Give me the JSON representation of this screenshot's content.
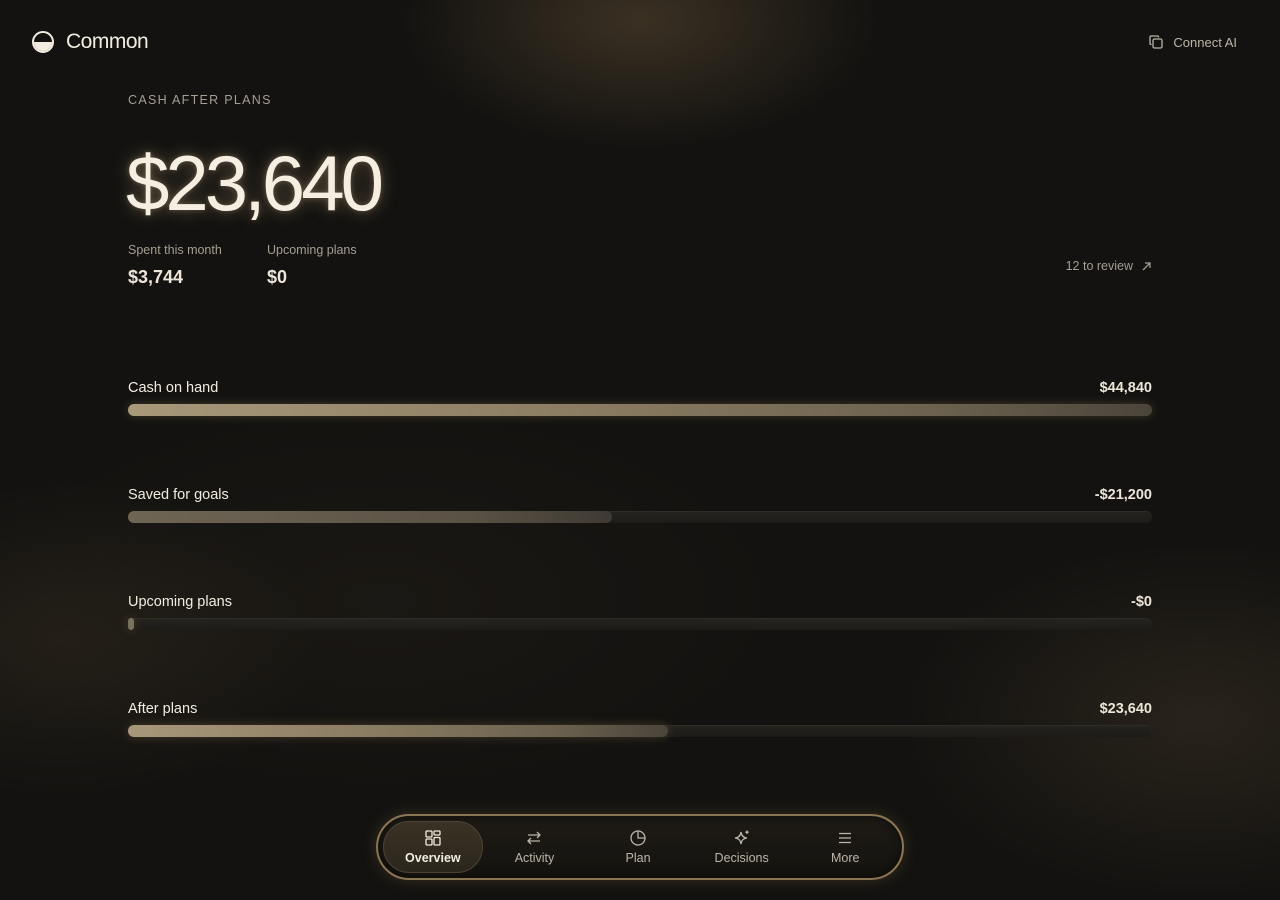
{
  "brand": {
    "name": "Common",
    "logo_icon": "half-circle-logo"
  },
  "header": {
    "connect_label": "Connect AI",
    "connect_icon": "copy-icon"
  },
  "hero": {
    "overline": "CASH AFTER PLANS",
    "value": "$23,640"
  },
  "stats": [
    {
      "label": "Spent this month",
      "value": "$3,744"
    },
    {
      "label": "Upcoming plans",
      "value": "$0"
    }
  ],
  "review": {
    "label": "12 to review",
    "icon": "arrow-up-right-icon"
  },
  "bars": [
    {
      "label": "Cash on hand",
      "value": "$44,840",
      "fill_fraction": 1.0,
      "style": "bright"
    },
    {
      "label": "Saved for goals",
      "value": "-$21,200",
      "fill_fraction": 0.473,
      "style": "dim"
    },
    {
      "label": "Upcoming plans",
      "value": "-$0",
      "fill_fraction": 0.005,
      "style": "tiny"
    },
    {
      "label": "After plans",
      "value": "$23,640",
      "fill_fraction": 0.527,
      "style": "bright"
    }
  ],
  "nav": {
    "items": [
      {
        "label": "Overview",
        "icon": "grid-icon",
        "active": true
      },
      {
        "label": "Activity",
        "icon": "swap-arrows-icon",
        "active": false
      },
      {
        "label": "Plan",
        "icon": "pie-chart-icon",
        "active": false
      },
      {
        "label": "Decisions",
        "icon": "sparkle-icon",
        "active": false
      },
      {
        "label": "More",
        "icon": "menu-icon",
        "active": false
      }
    ]
  },
  "colors": {
    "background": "#131210",
    "accent": "#a8987a",
    "nav_border": "#8a7654",
    "text": "#f2ece0"
  }
}
